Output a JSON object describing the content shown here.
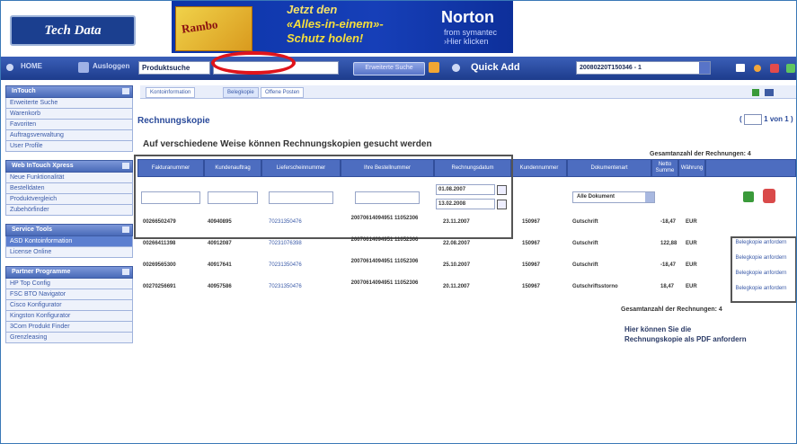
{
  "header": {
    "logo_text": "Tech Data",
    "banner": {
      "image_text": "Rambo",
      "line1": "Jetzt den",
      "line2": "«Alles-in-einem»-",
      "line3": "Schutz holen!",
      "brand": "Norton",
      "brand_sub1": "from symantec",
      "brand_sub2": "›Hier klicken"
    }
  },
  "navbar": {
    "home_label": "HOME",
    "ausloggen_label": "Ausloggen",
    "search_select_value": "Produktsuche",
    "search_value": "",
    "search_button_label": "Erweiterte Suche",
    "quick_add_label": "Quick Add",
    "order_select_value": "20080220T150346 - 1"
  },
  "sidebar": {
    "sections": [
      {
        "title": "InTouch",
        "items": [
          "Erweiterte Suche",
          "Warenkorb",
          "Favoriten",
          "Auftragsverwaltung",
          "User Profile"
        ]
      },
      {
        "title": "Web InTouch Xpress",
        "items": [
          "Neue Funktionalität",
          "Bestelldaten",
          "Produktvergleich",
          "Zubehörfinder"
        ]
      },
      {
        "title": "Service Tools",
        "items": [
          "ASD Kontoinformation",
          "License Online"
        ]
      },
      {
        "title": "Partner Programme",
        "items": [
          "HP Top Config",
          "FSC BTO Navigator",
          "Cisco Konfigurator",
          "Kingston Konfigurator",
          "3Com Produkt Finder",
          "Grenzleasing"
        ]
      }
    ]
  },
  "tabs": [
    "Kontoinformation",
    "Belegkopie",
    "Offene Posten"
  ],
  "main": {
    "title": "Rechnungskopie",
    "pager": "1 von 1",
    "headline": "Auf verschiedene Weise können Rechnungskopien gesucht werden",
    "total_label": "Gesamtanzahl der Rechnungen: 4",
    "pdf_note_line1": "Hier können Sie die",
    "pdf_note_line2": "Rechnungskopie als PDF anfordern"
  },
  "table": {
    "columns": [
      "Fakturanummer",
      "Kundenauftrag",
      "Lieferscheinnummer",
      "Ihre Bestellnummer",
      "Rechnungsdatum",
      "Kundennummer",
      "Dokumentenart",
      "Netto Summe",
      "Währung"
    ],
    "filters": {
      "date_from": "01.08.2007",
      "date_to": "13.02.2008",
      "doc_type": "Alle Dokument"
    },
    "rows": [
      {
        "faktura": "00266502479",
        "auftrag": "40940895",
        "liefer": "70231350476",
        "bestell": "20070614094951 11052306",
        "datum": "23.11.2007",
        "kunde": "150967",
        "art": "Gutschrift",
        "summe": "-18,47",
        "waehrung": "EUR"
      },
      {
        "faktura": "00266411398",
        "auftrag": "40912087",
        "liefer": "70231076398",
        "bestell": "20070614094951 11052306",
        "datum": "22.08.2007",
        "kunde": "150967",
        "art": "Gutschrift",
        "summe": "122,88",
        "waehrung": "EUR"
      },
      {
        "faktura": "00269565300",
        "auftrag": "40917641",
        "liefer": "70231350476",
        "bestell": "20070614094951 11052306",
        "datum": "25.10.2007",
        "kunde": "150967",
        "art": "Gutschrift",
        "summe": "-18,47",
        "waehrung": "EUR"
      },
      {
        "faktura": "00270256691",
        "auftrag": "40957586",
        "liefer": "70231350476",
        "bestell": "20070614094951 11052306",
        "datum": "20.11.2007",
        "kunde": "150967",
        "art": "Gutschriftsstorno",
        "summe": "18,47",
        "waehrung": "EUR"
      }
    ],
    "request_label": "Belegkopie anfordern"
  }
}
